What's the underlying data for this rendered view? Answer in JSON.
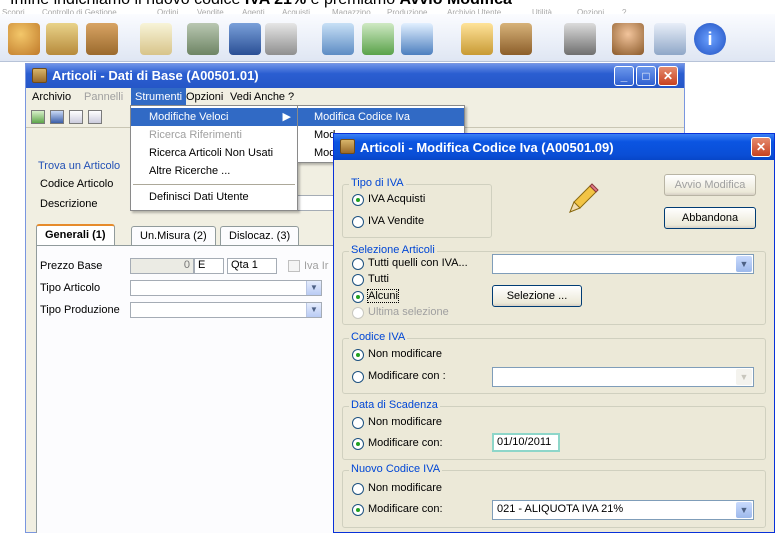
{
  "caption": {
    "text": "Infine indichiamo il nuovo codice IVA 21% e premiamo Avvio Modifica"
  },
  "behind_menu": [
    "Scopri",
    "Controllo di Gestione",
    "Ordini",
    "Vendite",
    "Agenti",
    "Acquisti",
    "Magazzino",
    "Produzione",
    "Archivio Utente",
    "Utilità",
    "Opzioni",
    "?"
  ],
  "main_window": {
    "title": "Articoli - Dati di Base  (A00501.01)",
    "menu": [
      "Archivio",
      "Pannelli",
      "Strumenti",
      "Opzioni",
      "Vedi Anche",
      "?"
    ],
    "group_title": "Trova un Articolo",
    "codice_label": "Codice Articolo",
    "descrizione_label": "Descrizione",
    "tabs": [
      "Generali (1)",
      "Un.Misura (2)",
      "Dislocaz. (3)"
    ],
    "prezzo_base_label": "Prezzo Base",
    "prezzo_value": "0",
    "prezzo_flag": "E",
    "qta_label": "Qta 1",
    "iva_checkbox_label": "Iva Ir",
    "tipo_articolo_label": "Tipo Articolo",
    "tipo_produzione_label": "Tipo Produzione"
  },
  "strumenti_menu": {
    "items": [
      "Modifiche Veloci",
      "Ricerca Riferimenti",
      "Ricerca Articoli Non Usati",
      "Altre Ricerche ...",
      "Definisci Dati Utente"
    ]
  },
  "submenu": {
    "items": [
      "Modifica Codice Iva",
      "Mod",
      "Mod"
    ]
  },
  "dialog": {
    "title": "Articoli - Modifica Codice Iva  (A00501.09)",
    "tipo_iva": {
      "title": "Tipo di IVA",
      "acquisti": "IVA Acquisti",
      "vendite": "IVA Vendite"
    },
    "avvio_label": "Avvio Modifica",
    "abbandona_label": "Abbandona",
    "selezione_articoli": {
      "title": "Selezione Articoli",
      "tutti_quelli": "Tutti quelli con IVA...",
      "tutti": "Tutti",
      "alcuni": "Alcuni",
      "ultima": "Ultima selezione",
      "selezione_btn": "Selezione ..."
    },
    "codice_iva": {
      "title": "Codice IVA",
      "non_modificare": "Non modificare",
      "modificare": "Modificare con :"
    },
    "data_scadenza": {
      "title": "Data di Scadenza",
      "non_modificare": "Non modificare",
      "modificare": "Modificare con:",
      "value": "01/10/2011"
    },
    "nuovo_codice": {
      "title": "Nuovo Codice IVA",
      "non_modificare": "Non modificare",
      "modificare": "Modificare con:",
      "value": "021 - ALIQUOTA IVA 21%"
    }
  },
  "colors": {
    "accent": "#316ac5",
    "title_blue": "#0a4ed6",
    "group_text": "#0046d5"
  }
}
